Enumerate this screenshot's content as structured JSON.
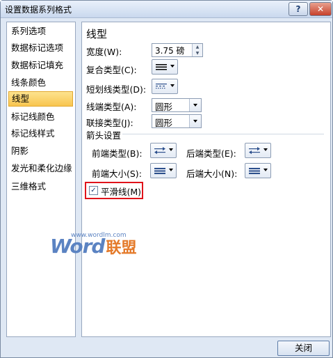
{
  "window": {
    "title": "设置数据系列格式",
    "help_label": "?",
    "close_label": "✕"
  },
  "nav": {
    "items": [
      {
        "label": "系列选项"
      },
      {
        "label": "数据标记选项"
      },
      {
        "label": "数据标记填充"
      },
      {
        "label": "线条颜色"
      },
      {
        "label": "线型"
      },
      {
        "label": "标记线颜色"
      },
      {
        "label": "标记线样式"
      },
      {
        "label": "阴影"
      },
      {
        "label": "发光和柔化边缘"
      },
      {
        "label": "三维格式"
      }
    ],
    "selected": "线型"
  },
  "panel": {
    "heading": "线型",
    "width": {
      "label": "宽度(W):",
      "value": "3.75 磅"
    },
    "compound_type": {
      "label": "复合类型(C):"
    },
    "dash_type": {
      "label": "短划线类型(D):"
    },
    "cap_type": {
      "label": "线端类型(A):",
      "value": "圆形"
    },
    "join_type": {
      "label": "联接类型(J):",
      "value": "圆形"
    },
    "arrow_section": {
      "heading": "箭头设置",
      "begin_type_label": "前端类型(B):",
      "end_type_label": "后端类型(E):",
      "begin_size_label": "前端大小(S):",
      "end_size_label": "后端大小(N):"
    },
    "smoothed_line": {
      "label": "平滑线(M)",
      "checked": true,
      "check_glyph": "✓"
    }
  },
  "footer": {
    "close_label": "关闭"
  },
  "watermark": {
    "word": "Word",
    "cn": "联盟",
    "url": "www.wordlm.com"
  }
}
